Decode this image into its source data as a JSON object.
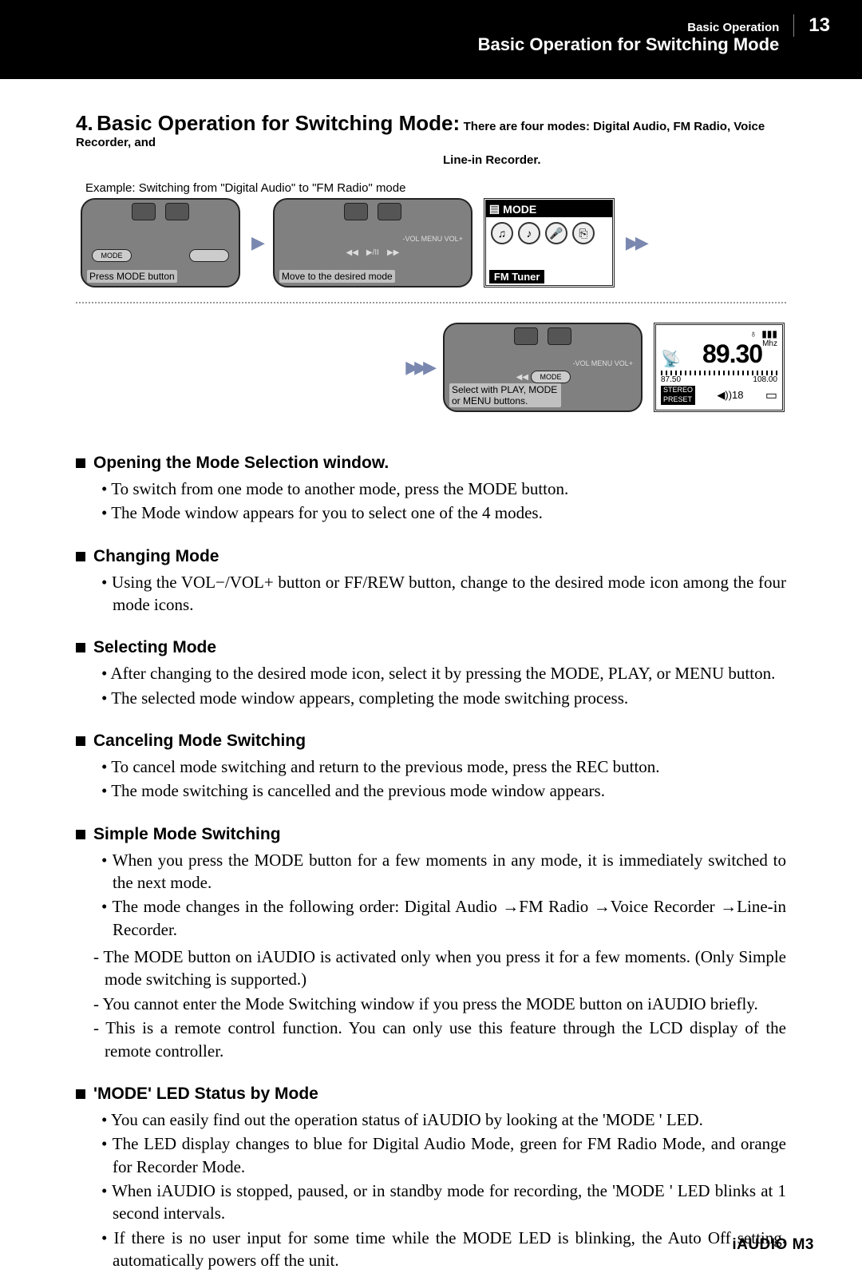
{
  "header": {
    "small": "Basic Operation",
    "title": "Basic Operation for Switching Mode",
    "page": "13"
  },
  "main_title": {
    "num": "4.",
    "text": "Basic Operation for Switching Mode:",
    "note1": "There are four modes: Digital Audio, FM Radio, Voice Recorder, and",
    "note2": "Line-in Recorder."
  },
  "example_line": "Example: Switching from \"Digital Audio\" to \"FM Radio\" mode",
  "diagrams": {
    "step1_caption": "Press MODE button",
    "step2_caption": "Move to the desired mode",
    "step4_caption": "Select with PLAY, MODE or MENU buttons.",
    "mode_btn": "MODE",
    "lcd_top": "MODE",
    "lcd_bottom": "FM Tuner",
    "menu_strip": "-VOL  MENU  VOL+",
    "ctrl_rew": "◀◀",
    "ctrl_play": "▶/II",
    "ctrl_ff": "▶▶",
    "fm": {
      "freq": "89.30",
      "unit": "Mhz",
      "low": "87.50",
      "high": "108.00",
      "stereo": "STEREO",
      "preset": "PRESET",
      "vol": "◀))18",
      "batt": "▮▮▮"
    }
  },
  "sections": [
    {
      "title": "Opening the Mode Selection window.",
      "items": [
        "To switch from one mode to another mode, press the MODE button.",
        "The Mode window appears for you to select one of the 4 modes."
      ]
    },
    {
      "title": "Changing Mode",
      "items": [
        "Using the VOL−/VOL+ button or FF/REW button, change to the desired mode icon among the four mode icons."
      ]
    },
    {
      "title": "Selecting Mode",
      "items": [
        "After changing to the desired mode icon, select it by pressing the MODE, PLAY, or MENU button.",
        "The selected mode window appears, completing the mode switching process."
      ]
    },
    {
      "title": "Canceling Mode Switching",
      "items": [
        "To cancel mode switching and return to the previous mode, press the REC button.",
        "The mode switching is cancelled and the previous mode window appears."
      ]
    },
    {
      "title": "Simple Mode Switching",
      "items": [
        "When you press the MODE button for a few moments in any mode, it is immediately switched to the next mode.",
        "The mode changes in the following order: Digital Audio →FM Radio →Voice Recorder →Line-in Recorder."
      ],
      "subitems": [
        "The MODE button on iAUDIO is activated only when you press it for a few moments. (Only Simple mode switching is supported.)",
        "You cannot enter the Mode Switching window if you press the MODE button on iAUDIO briefly.",
        "This is a remote control function. You can only use this feature through the LCD display of the remote controller."
      ]
    },
    {
      "title": "'MODE' LED Status by Mode",
      "items": [
        "You can easily find out the operation status of iAUDIO by looking at the 'MODE ' LED.",
        "The LED display changes to blue for Digital Audio Mode, green for FM Radio Mode, and orange for Recorder Mode.",
        "When iAUDIO is stopped, paused, or in standby mode for recording, the 'MODE ' LED blinks at 1 second intervals.",
        "If there is no user input for some time while the MODE LED is blinking, the Auto Off setting. automatically powers off the unit."
      ]
    }
  ],
  "footer": "iAUDIO M3"
}
